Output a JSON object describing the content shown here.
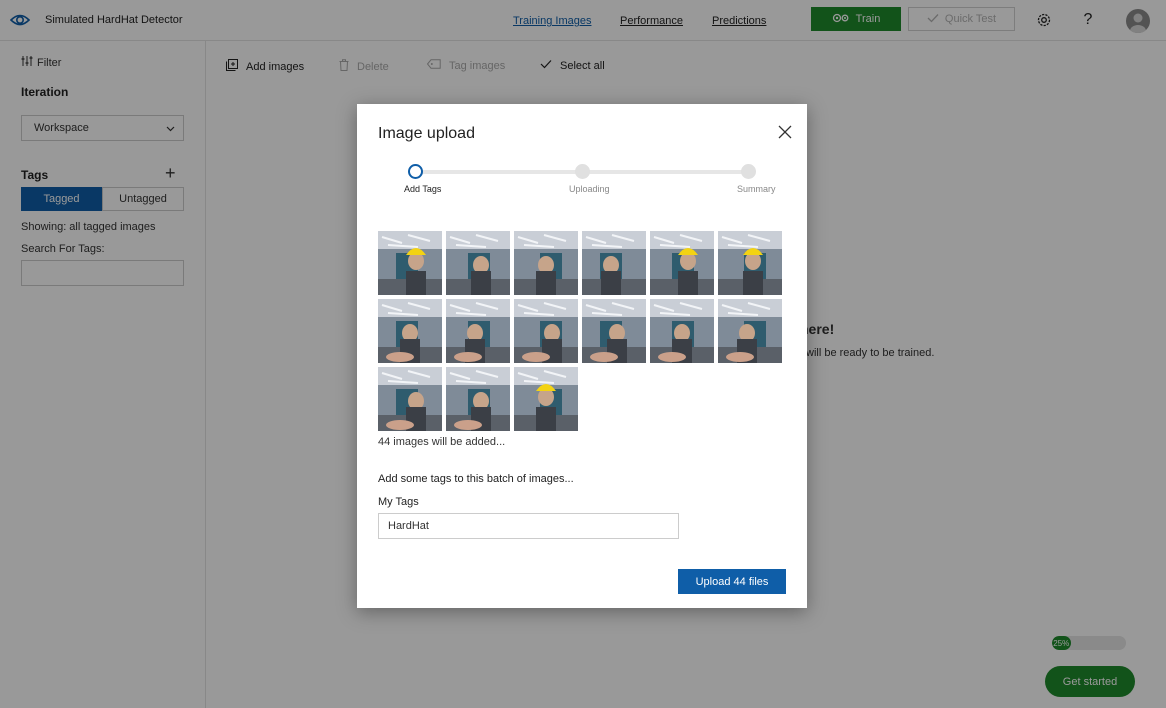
{
  "app": {
    "title": "Simulated HardHat Detector"
  },
  "nav": {
    "links": [
      {
        "label": "Training Images",
        "active": true
      },
      {
        "label": "Performance",
        "active": false
      },
      {
        "label": "Predictions",
        "active": false
      }
    ],
    "train_label": "Train",
    "quick_test_label": "Quick Test",
    "help_symbol": "?"
  },
  "sidebar": {
    "filter_label": "Filter",
    "iteration_heading": "Iteration",
    "iteration_value": "Workspace",
    "tags_heading": "Tags",
    "tagged_label": "Tagged",
    "untagged_label": "Untagged",
    "showing_text": "Showing: all tagged images",
    "search_label": "Search For Tags:",
    "search_value": ""
  },
  "toolbar": {
    "add_images": "Add images",
    "delete": "Delete",
    "tag_images": "Tag images",
    "select_all": "Select all"
  },
  "background": {
    "headline_fragment": "here!",
    "subtext_fragment": "will be ready to be trained."
  },
  "onboarding": {
    "progress_label": "25%",
    "progress_value": 0.25,
    "get_started_label": "Get started"
  },
  "modal": {
    "title": "Image upload",
    "steps": [
      {
        "label": "Add Tags",
        "state": "current"
      },
      {
        "label": "Uploading",
        "state": "todo"
      },
      {
        "label": "Summary",
        "state": "todo"
      }
    ],
    "thumbnail_count_visible": 15,
    "count_text": "44 images will be added...",
    "tags_prompt": "Add some tags to this batch of images...",
    "my_tags_label": "My Tags",
    "my_tags_value": "HardHat",
    "upload_label": "Upload 44 files"
  },
  "colors": {
    "accent_blue": "#0f5ea8",
    "train_green": "#1f8a2c"
  }
}
